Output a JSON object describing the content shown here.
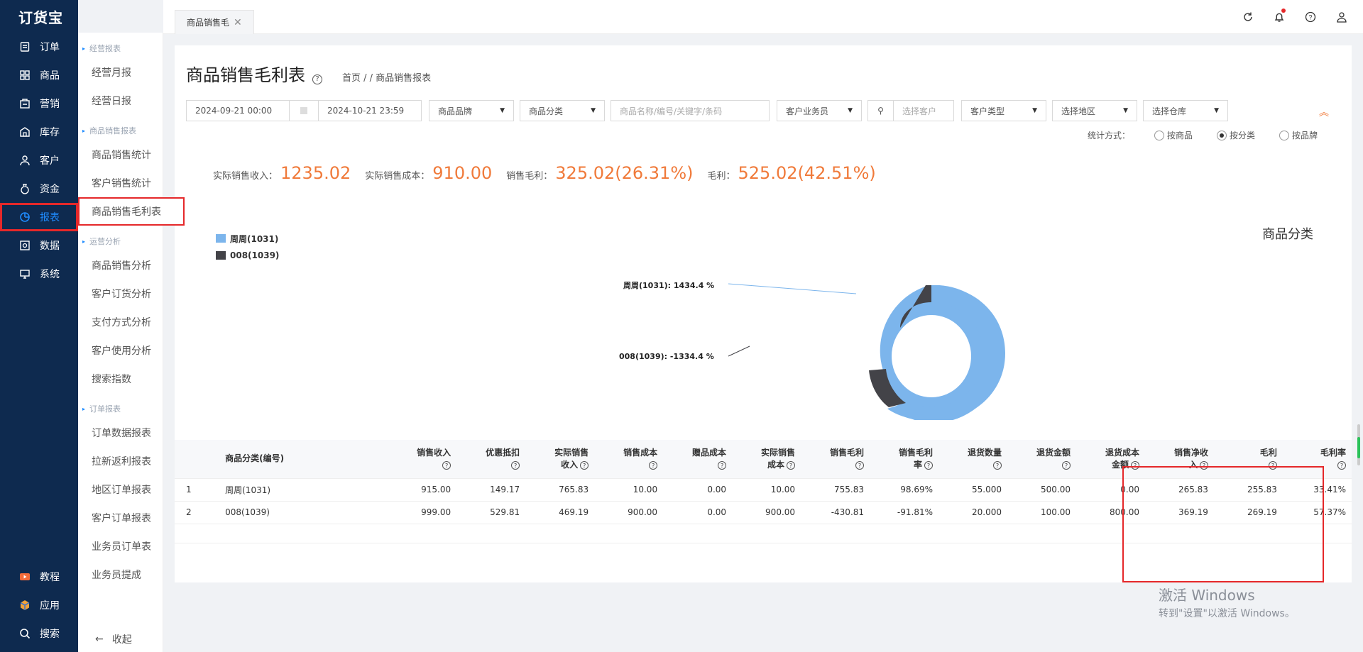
{
  "app": {
    "logo": "订货宝"
  },
  "nav": {
    "items": [
      {
        "label": "订单",
        "icon": "order-icon"
      },
      {
        "label": "商品",
        "icon": "grid-icon"
      },
      {
        "label": "营销",
        "icon": "marketing-icon"
      },
      {
        "label": "库存",
        "icon": "warehouse-icon"
      },
      {
        "label": "客户",
        "icon": "user-icon"
      },
      {
        "label": "资金",
        "icon": "money-bag-icon"
      },
      {
        "label": "报表",
        "icon": "pie-chart-icon"
      },
      {
        "label": "数据",
        "icon": "data-icon"
      },
      {
        "label": "系统",
        "icon": "monitor-icon"
      }
    ],
    "bottom": [
      {
        "label": "教程",
        "icon": "video-icon"
      },
      {
        "label": "应用",
        "icon": "apps-icon"
      },
      {
        "label": "搜索",
        "icon": "search-icon"
      }
    ]
  },
  "submenu": {
    "groups": [
      {
        "title": "经营报表",
        "items": [
          "经营月报",
          "经营日报"
        ]
      },
      {
        "title": "商品销售报表",
        "items": [
          "商品销售统计",
          "客户销售统计",
          "商品销售毛利表"
        ]
      },
      {
        "title": "运营分析",
        "items": [
          "商品销售分析",
          "客户订货分析",
          "支付方式分析",
          "客户使用分析",
          "搜索指数"
        ]
      },
      {
        "title": "订单报表",
        "items": [
          "订单数据报表",
          "拉新返利报表",
          "地区订单报表",
          "客户订单报表",
          "业务员订单表",
          "业务员提成"
        ]
      }
    ],
    "collapse": "收起"
  },
  "tab": {
    "label": "商品销售毛"
  },
  "page": {
    "title": "商品销售毛利表",
    "breadcrumb": "首页 / / 商品销售报表"
  },
  "filters": {
    "start_date": "2024-09-21 00:00",
    "end_date": "2024-10-21 23:59",
    "brand": "商品品牌",
    "category": "商品分类",
    "keyword_placeholder": "商品名称/编号/关键字/条码",
    "salesman": "客户业务员",
    "customer_placeholder": "选择客户",
    "customer_type": "客户类型",
    "region": "选择地区",
    "warehouse": "选择仓库"
  },
  "stat_mode": {
    "label": "统计方式：",
    "options": [
      "按商品",
      "按分类",
      "按品牌"
    ],
    "selected": "按分类"
  },
  "summary": {
    "revenue_label": "实际销售收入：",
    "revenue": "1235.02",
    "cost_label": "实际销售成本：",
    "cost": "910.00",
    "gross_label": "销售毛利：",
    "gross": "325.02(26.31%)",
    "margin_label": "毛利：",
    "margin": "525.02(42.51%)"
  },
  "chart_data": {
    "type": "pie",
    "title": "商品分类",
    "legend": [
      "周周(1031)",
      "008(1039)"
    ],
    "slices": [
      {
        "name": "周周(1031)",
        "label": "周周(1031): 1434.4 %",
        "value": 1434.4,
        "color": "#7cb5ec"
      },
      {
        "name": "008(1039)",
        "label": "008(1039): -1334.4 %",
        "value": -1334.4,
        "color": "#434348"
      }
    ]
  },
  "table": {
    "headers": [
      {
        "l1": "商品分类(编号)",
        "l2": "",
        "q": false
      },
      {
        "l1": "销售收入",
        "l2": "",
        "q": true
      },
      {
        "l1": "优惠抵扣",
        "l2": "",
        "q": true
      },
      {
        "l1": "实际销售",
        "l2": "收入",
        "q": true
      },
      {
        "l1": "销售成本",
        "l2": "",
        "q": true
      },
      {
        "l1": "赠品成本",
        "l2": "",
        "q": true
      },
      {
        "l1": "实际销售",
        "l2": "成本",
        "q": true
      },
      {
        "l1": "销售毛利",
        "l2": "",
        "q": true
      },
      {
        "l1": "销售毛利",
        "l2": "率",
        "q": true
      },
      {
        "l1": "退货数量",
        "l2": "",
        "q": true
      },
      {
        "l1": "退货金额",
        "l2": "",
        "q": true
      },
      {
        "l1": "退货成本",
        "l2": "金额",
        "q": true
      },
      {
        "l1": "销售净收",
        "l2": "入",
        "q": true
      },
      {
        "l1": "毛利",
        "l2": "",
        "q": true
      },
      {
        "l1": "毛利率",
        "l2": "",
        "q": true
      }
    ],
    "rows": [
      [
        "1",
        "周周(1031)",
        "915.00",
        "149.17",
        "765.83",
        "10.00",
        "0.00",
        "10.00",
        "755.83",
        "98.69%",
        "55.000",
        "500.00",
        "0.00",
        "265.83",
        "255.83",
        "33.41%"
      ],
      [
        "2",
        "008(1039)",
        "999.00",
        "529.81",
        "469.19",
        "900.00",
        "0.00",
        "900.00",
        "-430.81",
        "-91.81%",
        "20.000",
        "100.00",
        "800.00",
        "369.19",
        "269.19",
        "57.37%"
      ]
    ]
  },
  "watermark": {
    "line1": "激活 Windows",
    "line2": "转到\"设置\"以激活 Windows。"
  }
}
